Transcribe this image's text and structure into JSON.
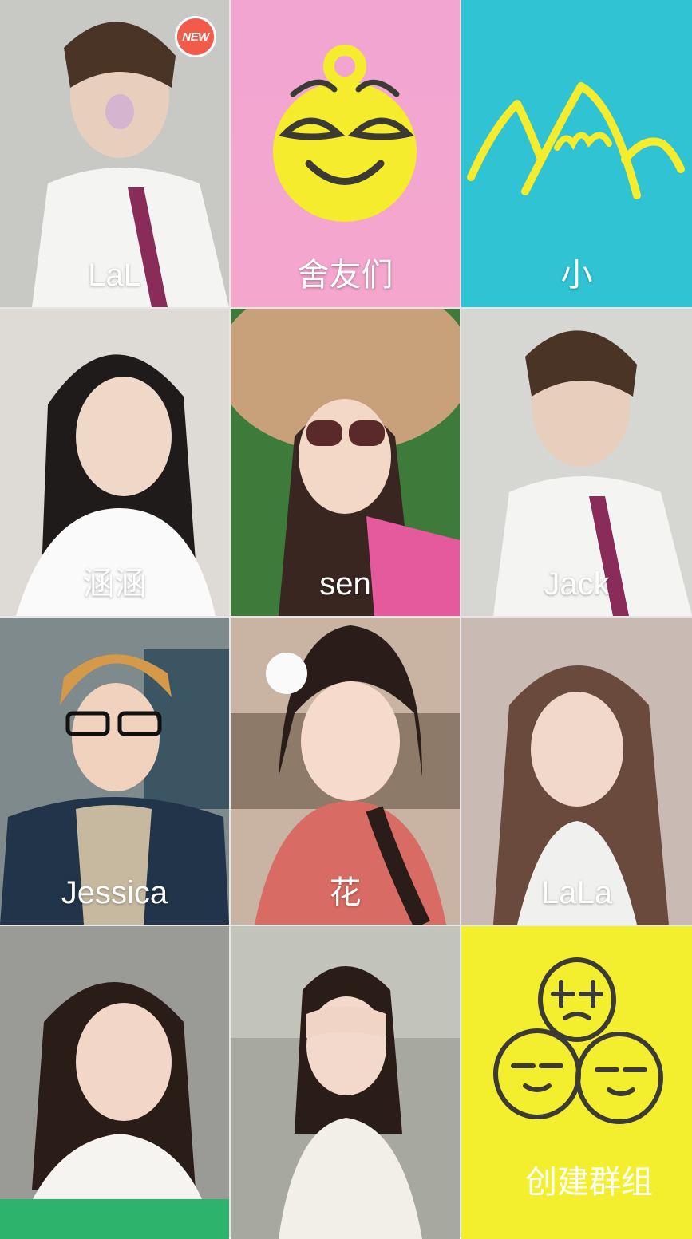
{
  "contacts": [
    {
      "name": "LaL",
      "badge": "NEW"
    },
    {
      "name": "舍友们"
    },
    {
      "name": "小"
    },
    {
      "name": "涵涵"
    },
    {
      "name": "sen"
    },
    {
      "name": "Jack"
    },
    {
      "name": "Jessica"
    },
    {
      "name": "花"
    },
    {
      "name": "LaLa"
    },
    {
      "name": ""
    },
    {
      "name": ""
    }
  ],
  "create_group": {
    "label": "创建群组"
  },
  "colors": {
    "pink_tile": "#f4a3cf",
    "teal_tile": "#2fc3d3",
    "yellow_tile": "#f4ef2e",
    "badge_red": "#f25a4a",
    "green_bar": "#2db36b",
    "smiley_yellow": "#f4ec2c",
    "icon_dark": "#3b3a35"
  },
  "icons": [
    "new-badge-icon",
    "smiley-face-icon",
    "mountain-icon",
    "create-group-faces-icon"
  ]
}
